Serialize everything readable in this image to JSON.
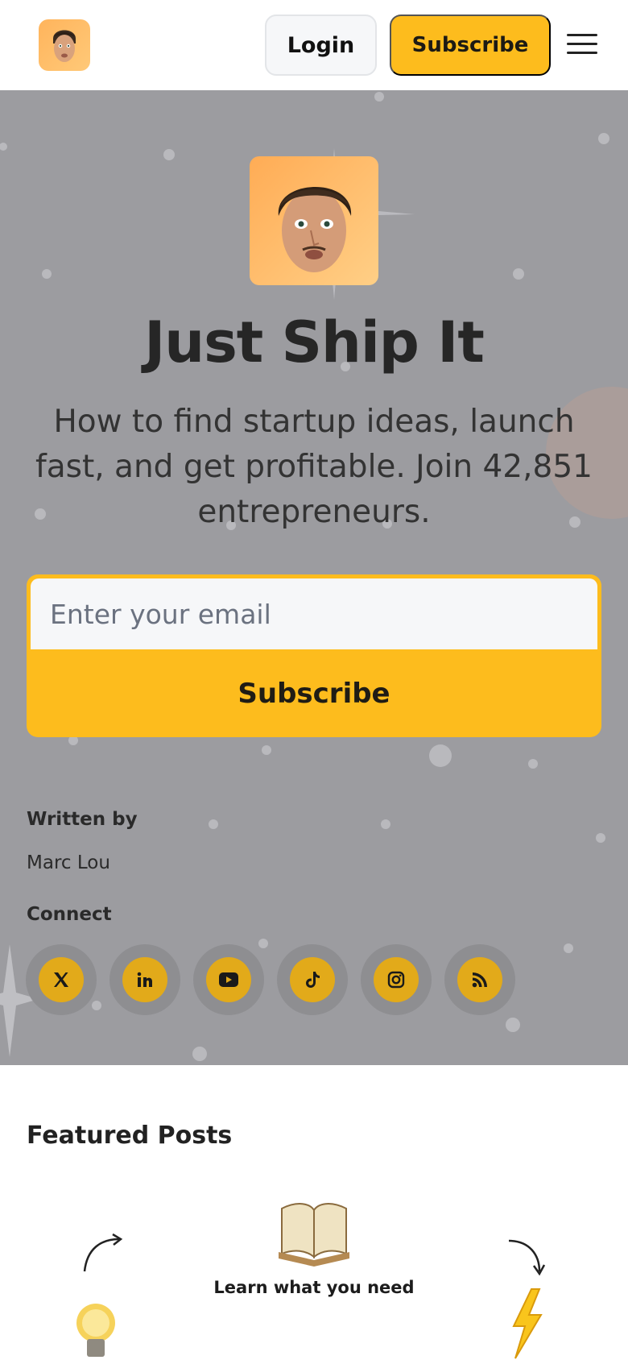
{
  "header": {
    "login_label": "Login",
    "subscribe_label": "Subscribe",
    "menu_icon": "hamburger-menu-icon",
    "logo_icon": "author-avatar"
  },
  "hero": {
    "title": "Just Ship It",
    "subtitle": "How to find startup ideas, launch fast, and get profitable. Join 42,851 entrepreneurs.",
    "email_placeholder": "Enter your email",
    "subscribe_label": "Subscribe",
    "written_by_label": "Written by",
    "author_name": "Marc Lou",
    "connect_label": "Connect",
    "socials": [
      {
        "name": "x",
        "icon": "x-icon"
      },
      {
        "name": "linkedin",
        "icon": "linkedin-icon"
      },
      {
        "name": "youtube",
        "icon": "youtube-icon"
      },
      {
        "name": "tiktok",
        "icon": "tiktok-icon"
      },
      {
        "name": "instagram",
        "icon": "instagram-icon"
      },
      {
        "name": "rss",
        "icon": "rss-icon"
      }
    ]
  },
  "featured": {
    "title": "Featured Posts",
    "posts": [
      {
        "caption": "Learn what you need"
      }
    ]
  },
  "colors": {
    "accent": "#fdbc1d",
    "hero_bg": "#9c9ca0",
    "social_inner": "#e2aa1a"
  }
}
